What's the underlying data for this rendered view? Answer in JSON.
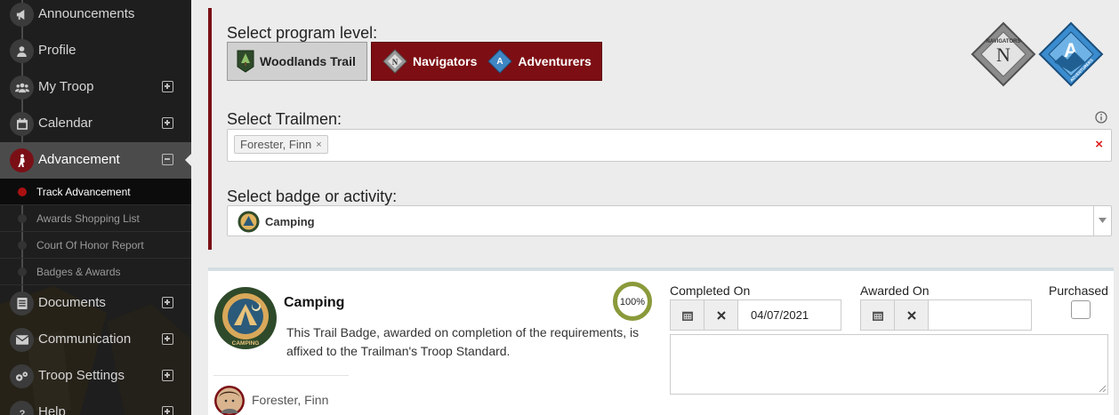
{
  "sidebar": {
    "items": [
      {
        "label": "Announcements",
        "icon": "megaphone-icon",
        "expand": "none"
      },
      {
        "label": "Profile",
        "icon": "user-icon",
        "expand": "none"
      },
      {
        "label": "My Troop",
        "icon": "group-icon",
        "expand": "plus"
      },
      {
        "label": "Calendar",
        "icon": "calendar-icon",
        "expand": "plus"
      },
      {
        "label": "Advancement",
        "icon": "hiker-icon",
        "expand": "minus",
        "active": true
      },
      {
        "label": "Documents",
        "icon": "document-icon",
        "expand": "plus"
      },
      {
        "label": "Communication",
        "icon": "envelope-icon",
        "expand": "plus"
      },
      {
        "label": "Troop Settings",
        "icon": "gears-icon",
        "expand": "plus"
      },
      {
        "label": "Help",
        "icon": "question-icon",
        "expand": "plus"
      }
    ],
    "subitems": [
      {
        "label": "Track Advancement",
        "active": true
      },
      {
        "label": "Awards Shopping List"
      },
      {
        "label": "Court Of Honor Report"
      },
      {
        "label": "Badges & Awards"
      }
    ]
  },
  "program": {
    "label": "Select program level:",
    "buttons": [
      {
        "label": "Woodlands Trail",
        "selected": false
      },
      {
        "label": "Navigators",
        "selected": true
      },
      {
        "label": "Adventurers",
        "selected": true
      }
    ],
    "logo_navigators_text": "NAVIGATORS",
    "logo_navigators_letter": "N",
    "logo_adventurers_text": "ADVENTURERS",
    "logo_adventurers_letter": "A"
  },
  "trailmen": {
    "label": "Select Trailmen:",
    "selected": "Forester, Finn",
    "tag_remove": "×",
    "clear": "×"
  },
  "badge_select": {
    "label": "Select badge or activity:",
    "value": "Camping"
  },
  "badge": {
    "title": "Camping",
    "emblem_text": "CAMPING",
    "progress": "100%",
    "progress_value": 1.0,
    "description": "This Trail Badge, awarded on completion of the requirements, is affixed to the Trailman's Troop Standard.",
    "member": "Forester, Finn",
    "completed_label": "Completed On",
    "completed_value": "04/07/2021",
    "awarded_label": "Awarded On",
    "awarded_value": "",
    "purchased_label": "Purchased",
    "purchased": false,
    "notes": ""
  },
  "colors": {
    "brand_red": "#7d0e13",
    "progress_green": "#8a9a3a",
    "sidebar_bg": "#1e1e1e"
  }
}
